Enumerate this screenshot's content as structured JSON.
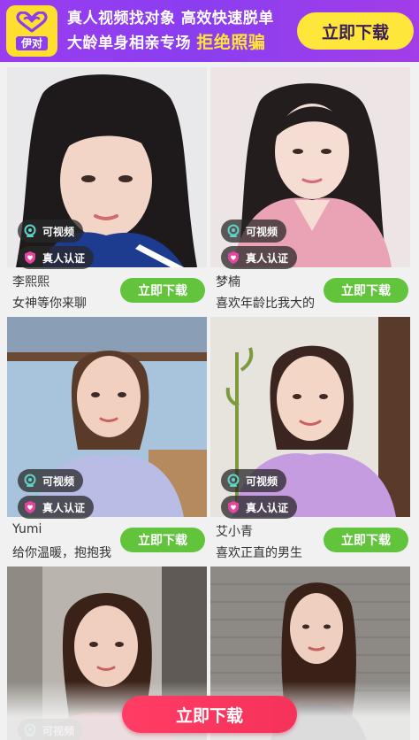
{
  "banner": {
    "logo_text": "伊对",
    "slogan_line1": "真人视频找对象  高效快速脱单",
    "slogan_line2_a": "大龄单身相亲专场",
    "slogan_line2_b": "拒绝照骗",
    "download_label": "立即下载",
    "colors": {
      "background": "#9b3cf0",
      "accent": "#ffe63b"
    }
  },
  "badges": {
    "video": "可视频",
    "verified": "真人认证"
  },
  "cards": [
    {
      "name": "李熙熙",
      "desc": "女神等你来聊",
      "cta": "立即下载"
    },
    {
      "name": "梦楠",
      "desc": "喜欢年龄比我大的",
      "cta": "立即下载"
    },
    {
      "name": "Yumi",
      "desc": "给你温暖，抱抱我",
      "cta": "立即下载"
    },
    {
      "name": "艾小青",
      "desc": "喜欢正直的男生",
      "cta": "立即下载"
    },
    {
      "name": "",
      "desc": "",
      "cta": ""
    },
    {
      "name": "",
      "desc": "",
      "cta": ""
    }
  ],
  "bottom_cta": {
    "label": "立即下载",
    "color": "#ff3c64"
  },
  "icons": [
    "heart-infinity-logo-icon",
    "webcam-icon",
    "shield-heart-icon"
  ]
}
